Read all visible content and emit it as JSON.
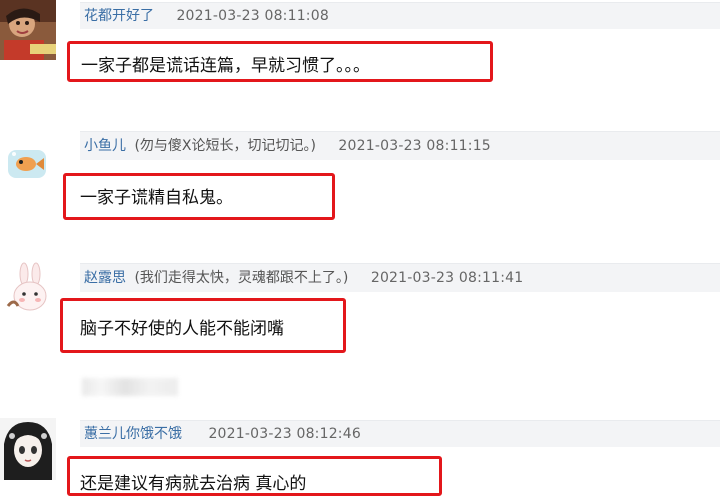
{
  "comments": [
    {
      "name": "花都开好了",
      "signature": "",
      "time": "2021-03-23 08:11:08",
      "content": "一家子都是谎话连篇，早就习惯了。。。"
    },
    {
      "name": "小鱼儿",
      "signature": "(勿与傻X论短长，切记切记。)",
      "time": "2021-03-23 08:11:15",
      "content": "一家子谎精自私鬼。"
    },
    {
      "name": "赵露思",
      "signature": "(我们走得太快，灵魂都跟不上了。)",
      "time": "2021-03-23 08:11:41",
      "content": "脑子不好使的人能不能闭嘴"
    },
    {
      "name": "蕙兰儿你饿不饿",
      "signature": "",
      "time": "2021-03-23 08:12:46",
      "content": "还是建议有病就去治病 真心的"
    }
  ],
  "colors": {
    "highlight": "#e3171b",
    "username": "#3a6ea5",
    "meta_background": "#f3f4f6"
  },
  "icons": [
    "avatar-photo",
    "fish-bowl-avatar",
    "bunny-avatar",
    "anime-girl-avatar"
  ]
}
